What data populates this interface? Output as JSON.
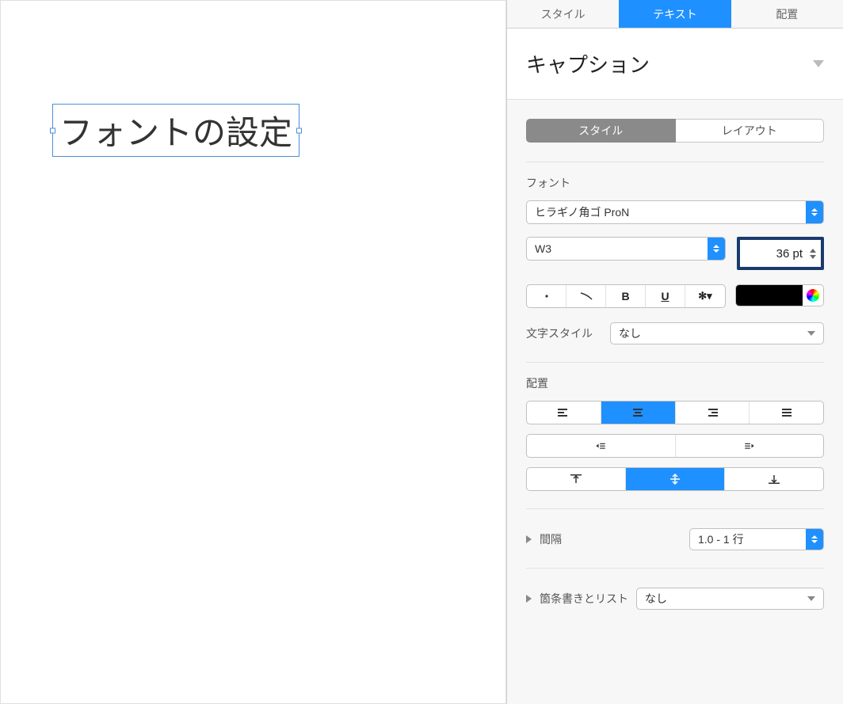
{
  "canvas": {
    "text": "フォントの設定"
  },
  "tabs": {
    "style": "スタイル",
    "text": "テキスト",
    "arrange": "配置"
  },
  "preset": {
    "name": "キャプション"
  },
  "subtabs": {
    "style": "スタイル",
    "layout": "レイアウト"
  },
  "font": {
    "section_label": "フォント",
    "family": "ヒラギノ角ゴ ProN",
    "weight": "W3",
    "size": "36 pt",
    "bold": "B",
    "underline": "U"
  },
  "char_style": {
    "label": "文字スタイル",
    "value": "なし"
  },
  "alignment": {
    "label": "配置"
  },
  "spacing": {
    "label": "間隔",
    "value": "1.0 - 1 行"
  },
  "bullets": {
    "label": "箇条書きとリスト",
    "value": "なし"
  }
}
